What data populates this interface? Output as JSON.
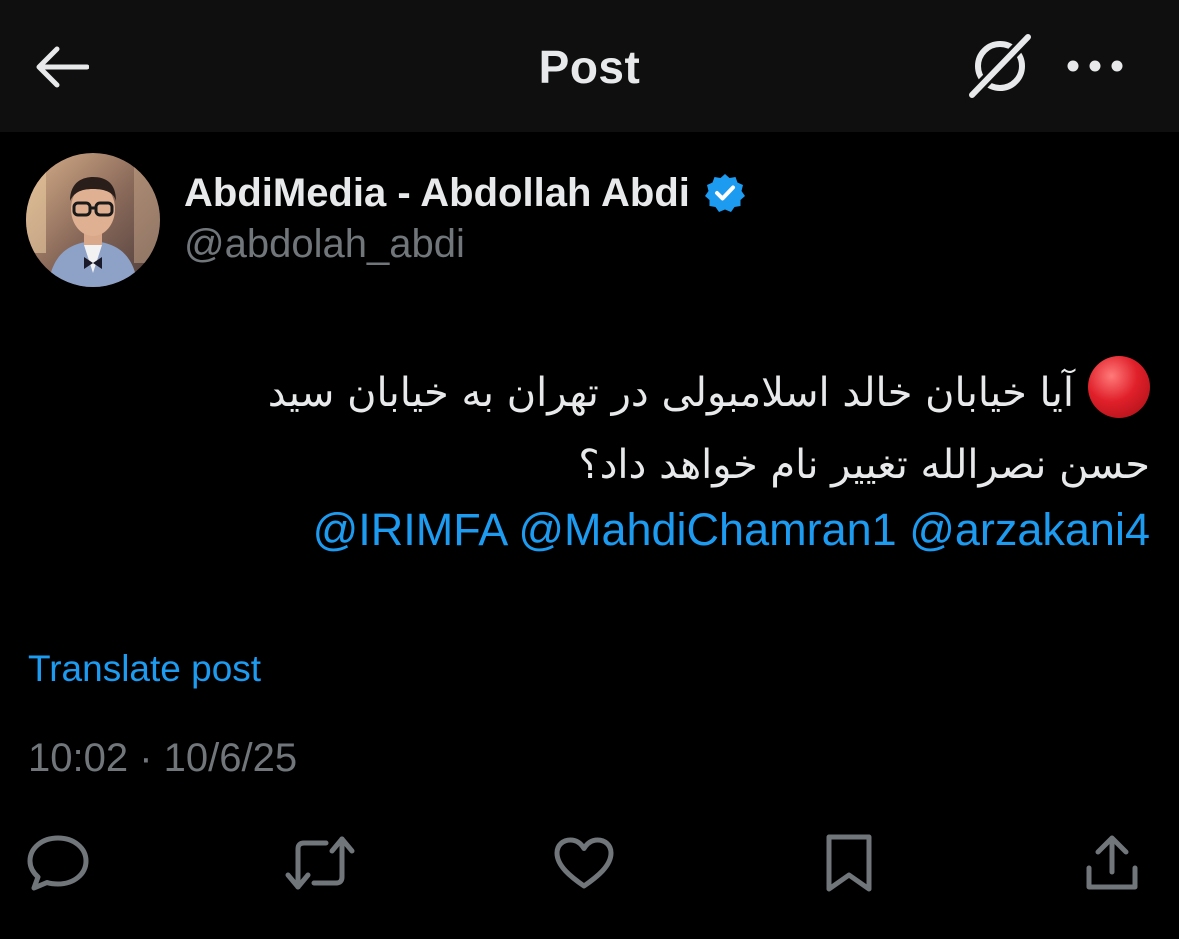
{
  "header": {
    "title": "Post",
    "back_icon": "arrow-left-icon",
    "grok_icon": "grok-icon",
    "more_icon": "more-horizontal-icon"
  },
  "author": {
    "display_name": "AbdiMedia - Abdollah Abdi",
    "handle": "@abdolah_abdi",
    "verified_icon": "verified-badge-icon"
  },
  "post": {
    "line1": "آیا خیابان خالد اسلامبولی در تهران به خیابان سید",
    "line2": "حسن نصرالله تغییر نام خواهد داد؟",
    "emoji": "red-circle-emoji",
    "mentions": [
      "@IRIMFA",
      "@MahdiChamran1",
      "@arzakani4"
    ],
    "translate_label": "Translate post",
    "timestamp": "10:02 · 10/6/25"
  },
  "actions": {
    "reply_icon": "reply-icon",
    "repost_icon": "repost-icon",
    "like_icon": "heart-icon",
    "bookmark_icon": "bookmark-icon",
    "share_icon": "share-icon"
  },
  "colors": {
    "background": "#000000",
    "header_background": "#0f0f0f",
    "text_primary": "#e7e9ea",
    "text_secondary": "#71767b",
    "accent": "#1d9bf0"
  }
}
